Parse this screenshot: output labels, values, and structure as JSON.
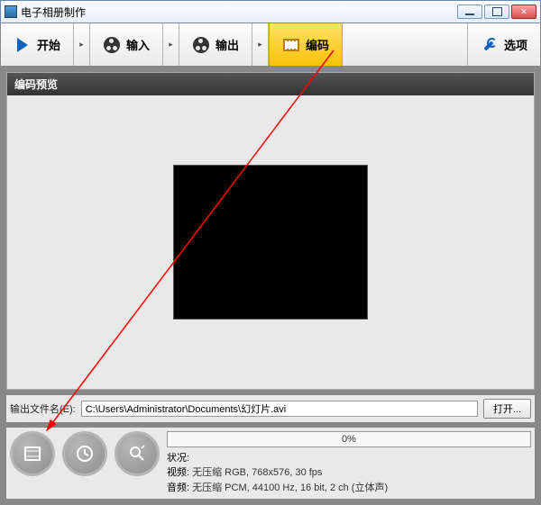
{
  "window": {
    "title": "电子相册制作"
  },
  "toolbar": {
    "start": "开始",
    "input": "输入",
    "output": "输出",
    "encode": "编码",
    "options": "选项"
  },
  "panel": {
    "header": "编码预览"
  },
  "file": {
    "label": "输出文件名(E):",
    "path": "C:\\Users\\Administrator\\Documents\\幻灯片.avi",
    "open": "打开..."
  },
  "progress": {
    "text": "0%"
  },
  "status": {
    "label": "状况:",
    "video_label": "视频:",
    "video": "无压缩 RGB, 768x576, 30 fps",
    "audio_label": "音频:",
    "audio": "无压缩 PCM, 44100 Hz, 16 bit, 2 ch (立体声)"
  }
}
